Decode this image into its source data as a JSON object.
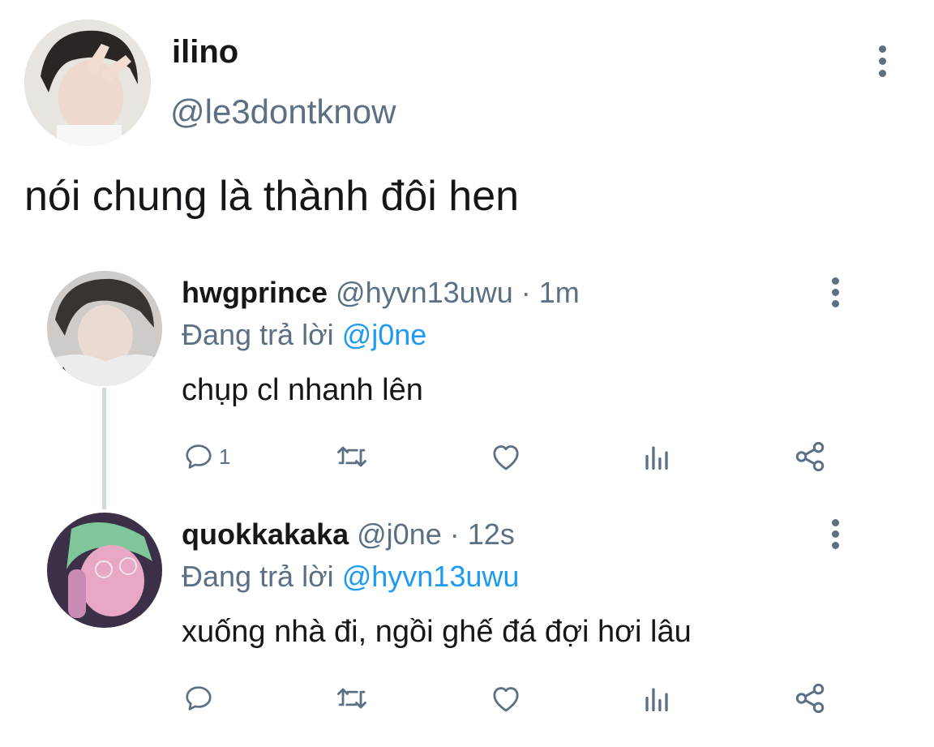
{
  "main_tweet": {
    "display_name": "ilino",
    "handle": "@le3dontknow",
    "text": "nói chung là thành đôi hen"
  },
  "replies": [
    {
      "display_name": "hwgprince",
      "handle": "@hyvn13uwu",
      "separator": "·",
      "time": "1m",
      "replying_label": "Đang trả lời",
      "replying_to": "@j0ne",
      "text": "chụp cl nhanh lên",
      "reply_count": "1"
    },
    {
      "display_name": "quokkakaka",
      "handle": "@j0ne",
      "separator": "·",
      "time": "12s",
      "replying_label": "Đang trả lời",
      "replying_to": "@hyvn13uwu",
      "text": "xuống nhà đi, ngồi ghế đá đợi hơi lâu",
      "reply_count": ""
    }
  ],
  "icons": {
    "reply": "speech-bubble",
    "retweet": "retweet-arrows",
    "like": "heart",
    "stats": "bar-chart",
    "share": "share-nodes",
    "more": "vertical-dots"
  },
  "colors": {
    "text": "#14171a",
    "secondary": "#5b7083",
    "link": "#1d9bf0",
    "thread_line": "#cfd9de"
  }
}
